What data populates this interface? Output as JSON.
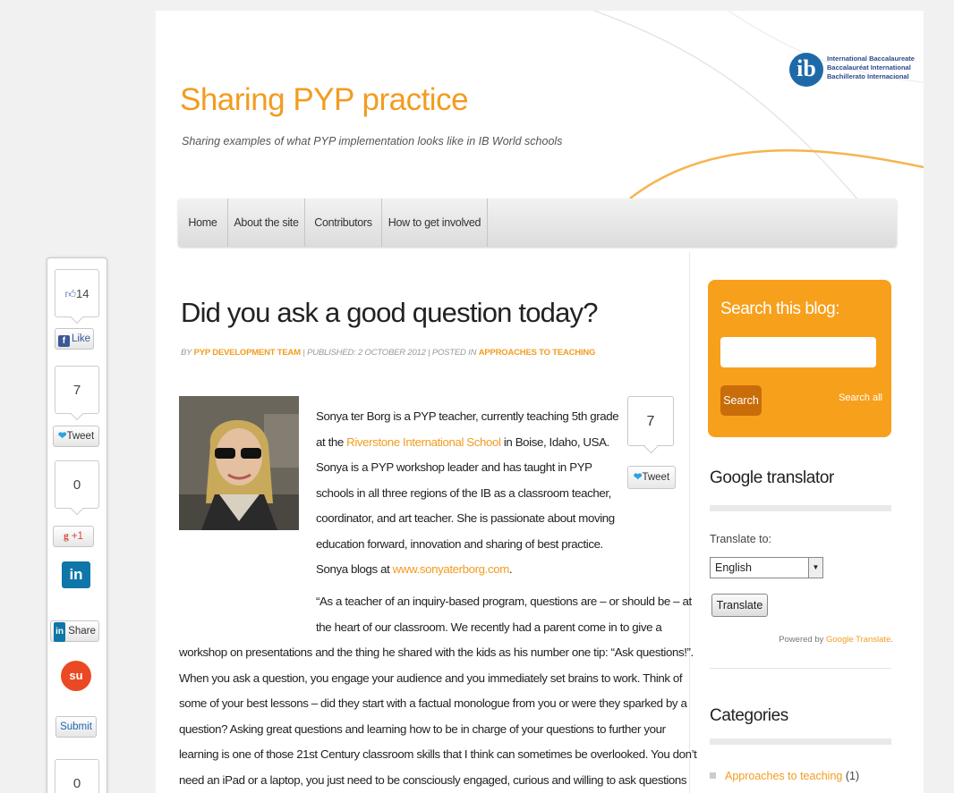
{
  "site": {
    "title": "Sharing PYP practice",
    "tagline": "Sharing examples of what PYP implementation looks like in IB World schools",
    "logo_lines": [
      "International Baccalaureate",
      "Baccalauréat International",
      "Bachillerato Internacional"
    ],
    "logo_letters": "ib",
    "accent_color": "#f29c1f"
  },
  "nav": {
    "items": [
      {
        "label": "Home"
      },
      {
        "label": "About the site"
      },
      {
        "label": "Contributors"
      },
      {
        "label": "How to get involved"
      }
    ]
  },
  "post": {
    "title": "Did you ask a good question today?",
    "meta": {
      "by": "BY",
      "author": "PYP DEVELOPMENT TEAM",
      "published": "| PUBLISHED: 2 OCTOBER 2012 | POSTED IN",
      "category": "APPROACHES TO TEACHING"
    },
    "para1_a": "Sonya ter Borg is a PYP teacher, currently teaching 5th grade at the ",
    "para1_link": "Riverstone International School",
    "para1_b": " in Boise, Idaho, USA.  Sonya is a PYP workshop leader and has taught in PYP schools in all three regions of the IB as a classroom teacher, coordinator, and art teacher. She is passionate about moving education forward, innovation and sharing of best practice. Sonya blogs at ",
    "para1_blog": "www.sonyaterborg.com",
    "para1_end": ".",
    "quote_top": "“As a teacher of an inquiry-based program, questions are – or should be – at the heart of our classroom. We recently had a parent come in to give a",
    "quote_rest": "workshop on presentations and the thing he shared with the kids as his number one tip: “Ask questions!”.  When you ask a question, you engage your audience and you immediately set brains to work.  Think of some of your best lessons – did they start with a factual monologue from you or were they sparked by a question? Asking great questions and learning how to be in charge of your questions to further your learning is one of those 21st Century classroom skills that I think can sometimes be overlooked.  You don’t need an iPad or a laptop, you just need to be consciously engaged, curious and willing to ask questions that you",
    "inline_tweet": {
      "count": "7",
      "label": "Tweet"
    }
  },
  "sidebar": {
    "search": {
      "title": "Search this blog:",
      "value": "",
      "button": "Search",
      "search_all": "Search all"
    },
    "translator": {
      "title": "Google translator",
      "label": "Translate to:",
      "selected": "English",
      "button": "Translate",
      "powered_by": "Powered by ",
      "powered_link": "Google Translate",
      "powered_end": "."
    },
    "categories": {
      "title": "Categories",
      "items": [
        {
          "label": "Approaches to teaching",
          "count": "(1)"
        }
      ]
    }
  },
  "sharebar": {
    "fb_count": "14",
    "fb_label": "Like",
    "tw_count": "7",
    "tw_label": "Tweet",
    "gp_count": "0",
    "gp_label": "+1",
    "li_label": "Share",
    "su_label": "Submit",
    "last_count": "0"
  }
}
